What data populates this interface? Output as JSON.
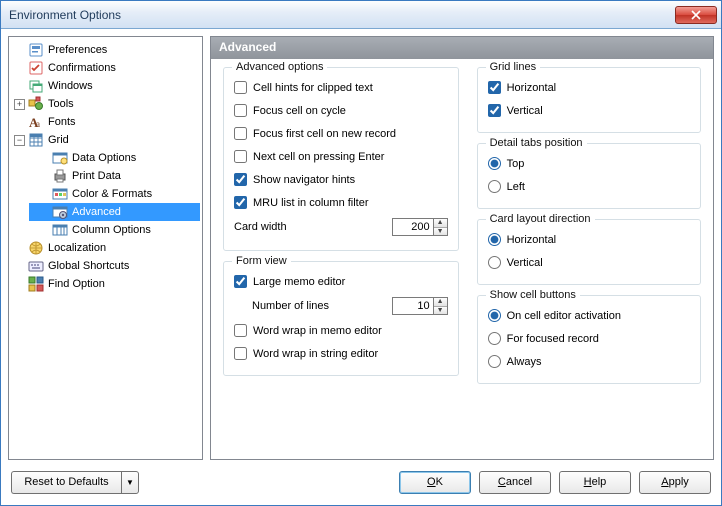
{
  "window": {
    "title": "Environment Options"
  },
  "tree": {
    "items": [
      {
        "label": "Preferences",
        "icon": "prefs"
      },
      {
        "label": "Confirmations",
        "icon": "conf"
      },
      {
        "label": "Windows",
        "icon": "windows"
      },
      {
        "label": "Tools",
        "icon": "tools"
      },
      {
        "label": "Fonts",
        "icon": "fonts"
      },
      {
        "label": "Grid",
        "icon": "grid",
        "expanded": true,
        "children": [
          {
            "label": "Data Options",
            "icon": "dataopt"
          },
          {
            "label": "Print Data",
            "icon": "print"
          },
          {
            "label": "Color & Formats",
            "icon": "colorformat"
          },
          {
            "label": "Advanced",
            "icon": "advanced",
            "selected": true
          },
          {
            "label": "Column Options",
            "icon": "columns"
          }
        ]
      },
      {
        "label": "Localization",
        "icon": "loc"
      },
      {
        "label": "Global Shortcuts",
        "icon": "shortcut"
      },
      {
        "label": "Find Option",
        "icon": "find"
      }
    ]
  },
  "panel": {
    "title": "Advanced",
    "advanced_options": {
      "legend": "Advanced options",
      "cell_hints": "Cell hints for clipped text",
      "focus_cycle": "Focus cell on cycle",
      "focus_first": "Focus first cell on new record",
      "next_cell_enter": "Next cell on pressing Enter",
      "show_nav_hints": "Show navigator hints",
      "mru_list": "MRU list in column filter",
      "card_width_label": "Card width",
      "card_width_value": "200",
      "checked": {
        "cell_hints": false,
        "focus_cycle": false,
        "focus_first": false,
        "next_cell_enter": false,
        "show_nav_hints": true,
        "mru_list": true
      }
    },
    "form_view": {
      "legend": "Form view",
      "large_memo": "Large memo editor",
      "num_lines_label": "Number of lines",
      "num_lines_value": "10",
      "ww_memo": "Word wrap in memo editor",
      "ww_string": "Word wrap in string editor",
      "checked": {
        "large_memo": true,
        "ww_memo": false,
        "ww_string": false
      }
    },
    "grid_lines": {
      "legend": "Grid lines",
      "horizontal": "Horizontal",
      "vertical": "Vertical",
      "checked": {
        "horizontal": true,
        "vertical": true
      }
    },
    "detail_tabs": {
      "legend": "Detail tabs position",
      "top": "Top",
      "left": "Left",
      "value": "top"
    },
    "card_layout": {
      "legend": "Card layout direction",
      "horizontal": "Horizontal",
      "vertical": "Vertical",
      "value": "horizontal"
    },
    "show_cell": {
      "legend": "Show cell buttons",
      "on_activation": "On cell editor activation",
      "for_focused": "For focused record",
      "always": "Always",
      "value": "on_activation"
    }
  },
  "footer": {
    "reset": "Reset to Defaults",
    "ok": "OK",
    "cancel": "Cancel",
    "help": "Help",
    "apply": "Apply"
  }
}
